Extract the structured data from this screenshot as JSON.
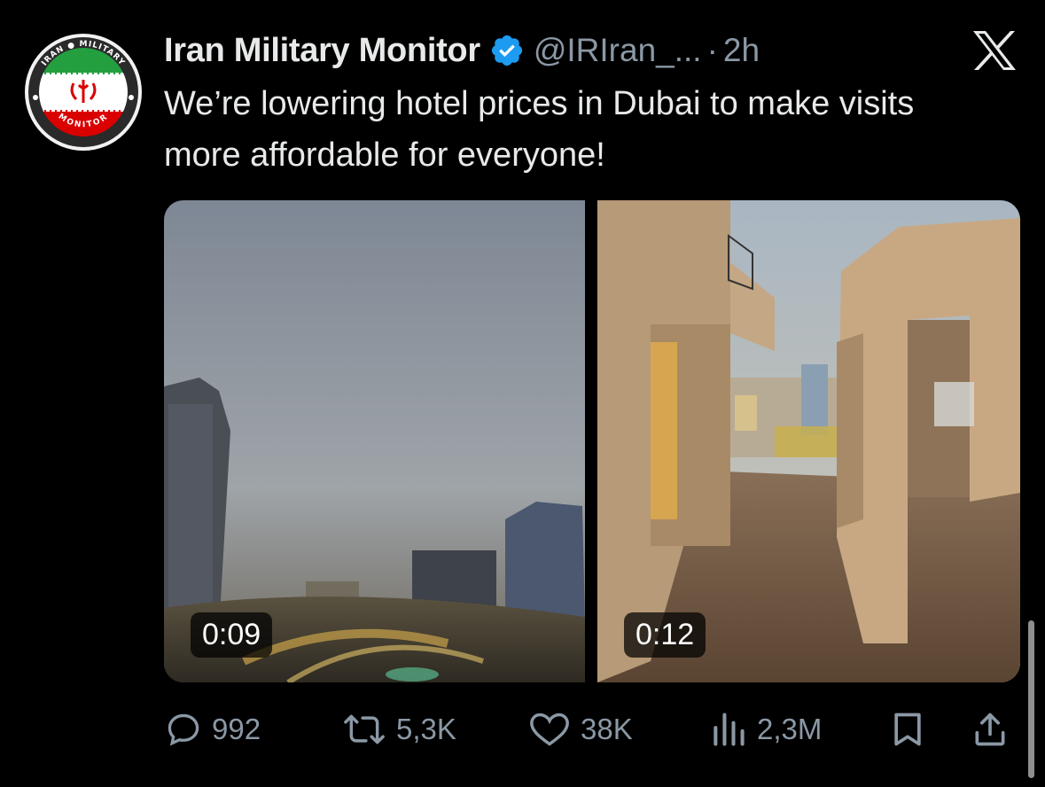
{
  "tweet": {
    "author_name": "Iran Military Monitor",
    "handle": "@IRIran_...",
    "separator": "·",
    "time": "2h",
    "text": "We’re lowering hotel prices in Dubai to make visits more affordable for everyone!",
    "verified": true
  },
  "avatar": {
    "ring_text_top": "IRAN MILITARY",
    "ring_text_bottom": "MONITOR",
    "flag_colors": [
      "#239f40",
      "#ffffff",
      "#da0000"
    ]
  },
  "media": {
    "videos": [
      {
        "duration": "0:09"
      },
      {
        "duration": "0:12"
      }
    ]
  },
  "actions": {
    "replies": "992",
    "reposts": "5,3K",
    "likes": "38K",
    "views": "2,3M"
  },
  "icons": [
    "x-logo-icon",
    "verified-badge-icon",
    "reply-icon",
    "retweet-icon",
    "like-icon",
    "views-icon",
    "bookmark-icon",
    "share-icon"
  ],
  "colors": {
    "background": "#000000",
    "text_primary": "#e7e9ea",
    "text_secondary": "#8b98a5",
    "verified_blue": "#1d9bf0"
  }
}
